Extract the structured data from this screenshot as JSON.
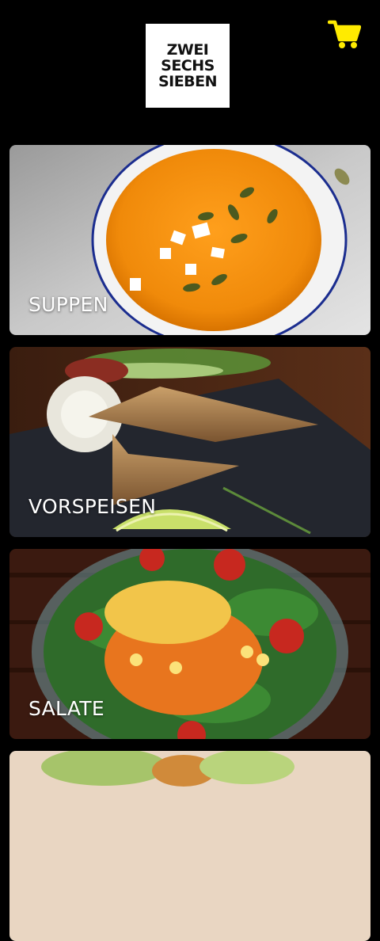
{
  "logo": {
    "line1": "ZWEI",
    "line2": "SECHS",
    "line3": "SIEBEN"
  },
  "cart": {
    "icon": "shopping-cart-icon",
    "color": "#ffeb00"
  },
  "categories": [
    {
      "label": "SUPPEN"
    },
    {
      "label": "VORSPEISEN"
    },
    {
      "label": "SALATE"
    },
    {
      "label": ""
    }
  ]
}
